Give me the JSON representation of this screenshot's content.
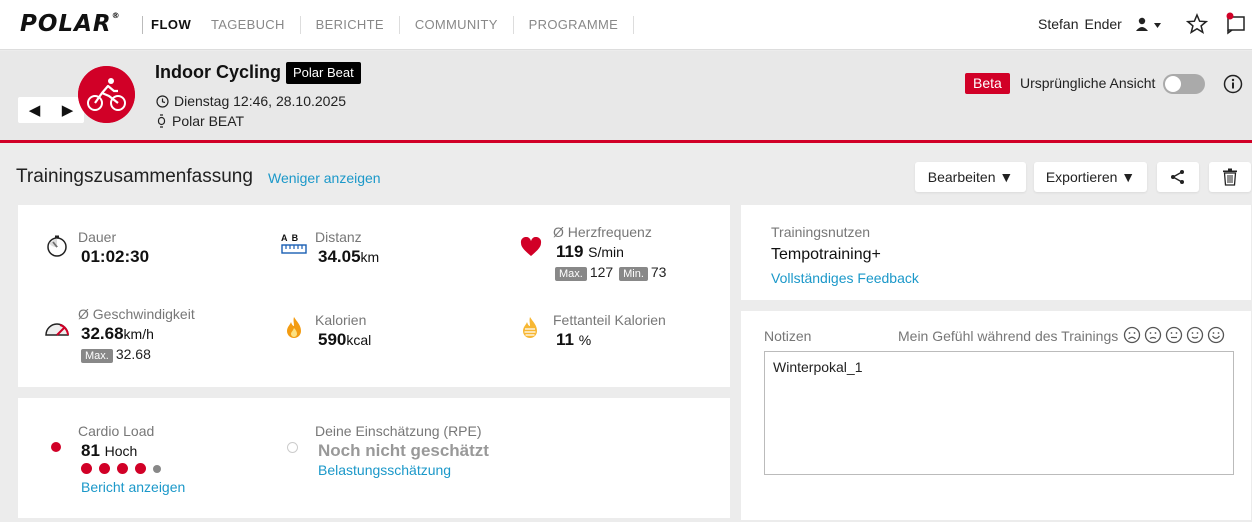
{
  "nav": {
    "logo": "POLAR",
    "app": "FLOW",
    "items": [
      "TAGEBUCH",
      "BERICHTE",
      "COMMUNITY",
      "PROGRAMME"
    ],
    "user_first": "Stefan",
    "user_last": "Ender"
  },
  "header": {
    "title": "Indoor Cycling",
    "device_badge": "Polar Beat",
    "date": "Dienstag 12:46, 28.10.2025",
    "device": "Polar BEAT",
    "beta": "Beta",
    "original_view": "Ursprüngliche Ansicht",
    "prev": "◀",
    "next": "▶",
    "accent": "#d10027"
  },
  "summary": {
    "title": "Trainingszusammenfassung",
    "less_link": "Weniger anzeigen",
    "edit": "Bearbeiten ▼",
    "export": "Exportieren ▼"
  },
  "stats": {
    "duration": {
      "label": "Dauer",
      "value": "01:02:30"
    },
    "distance": {
      "label": "Distanz",
      "value": "34.05",
      "unit": "km",
      "icon_text": "A  B"
    },
    "heart_rate": {
      "label": "Ø Herzfrequenz",
      "value": "119",
      "unit": "S/min",
      "max_label": "Max.",
      "max": "127",
      "min_label": "Min.",
      "min": "73"
    },
    "speed": {
      "label": "Ø Geschwindigkeit",
      "value": "32.68",
      "unit": "km/h",
      "max_label": "Max.",
      "max": "32.68"
    },
    "calories": {
      "label": "Kalorien",
      "value": "590",
      "unit": "kcal"
    },
    "fat": {
      "label": "Fettanteil Kalorien",
      "value": "11",
      "unit": "%"
    }
  },
  "load": {
    "label": "Cardio Load",
    "value": "81",
    "level": "Hoch",
    "dots_filled": 4,
    "dots_total": 5,
    "report_link": "Bericht anzeigen",
    "rpe_label": "Deine Einschätzung (RPE)",
    "rpe_value": "Noch nicht geschätzt",
    "rpe_link": "Belastungsschätzung"
  },
  "benefit": {
    "label": "Trainingsnutzen",
    "value": "Tempotraining+",
    "link": "Vollständiges Feedback"
  },
  "notes": {
    "label": "Notizen",
    "feeling_label": "Mein Gefühl während des Trainings",
    "text": "Winterpokal_1"
  }
}
